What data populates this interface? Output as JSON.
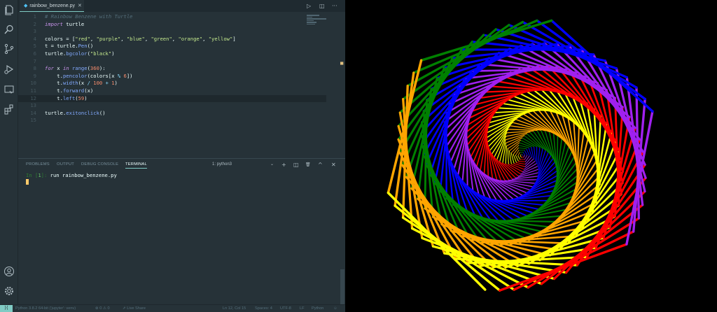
{
  "tab": {
    "filename": "rainbow_benzene.py",
    "close": "✕"
  },
  "editor_actions": {
    "run": "▷",
    "split": "◫",
    "more": "···"
  },
  "code_lines": [
    {
      "num": "1",
      "segments": [
        {
          "t": "# Rainbow Benzene with Turtle",
          "c": "cm"
        }
      ]
    },
    {
      "num": "2",
      "segments": [
        {
          "t": "import",
          "c": "kw"
        },
        {
          "t": " turtle",
          "c": ""
        }
      ]
    },
    {
      "num": "3",
      "segments": []
    },
    {
      "num": "4",
      "segments": [
        {
          "t": "colors = [",
          "c": ""
        },
        {
          "t": "\"red\"",
          "c": "st"
        },
        {
          "t": ", ",
          "c": ""
        },
        {
          "t": "\"purple\"",
          "c": "st"
        },
        {
          "t": ", ",
          "c": ""
        },
        {
          "t": "\"blue\"",
          "c": "st"
        },
        {
          "t": ", ",
          "c": ""
        },
        {
          "t": "\"green\"",
          "c": "st"
        },
        {
          "t": ", ",
          "c": ""
        },
        {
          "t": "\"orange\"",
          "c": "st"
        },
        {
          "t": ", ",
          "c": ""
        },
        {
          "t": "\"yellow\"",
          "c": "st"
        },
        {
          "t": "]",
          "c": ""
        }
      ]
    },
    {
      "num": "5",
      "segments": [
        {
          "t": "t = turtle.",
          "c": ""
        },
        {
          "t": "Pen",
          "c": "fn"
        },
        {
          "t": "()",
          "c": ""
        }
      ]
    },
    {
      "num": "6",
      "segments": [
        {
          "t": "turtle.",
          "c": ""
        },
        {
          "t": "bgcolor",
          "c": "fn"
        },
        {
          "t": "(",
          "c": ""
        },
        {
          "t": "\"black\"",
          "c": "st"
        },
        {
          "t": ")",
          "c": ""
        }
      ]
    },
    {
      "num": "7",
      "segments": []
    },
    {
      "num": "8",
      "segments": [
        {
          "t": "for",
          "c": "kw"
        },
        {
          "t": " x ",
          "c": ""
        },
        {
          "t": "in",
          "c": "kw"
        },
        {
          "t": " ",
          "c": ""
        },
        {
          "t": "range",
          "c": "fn"
        },
        {
          "t": "(",
          "c": ""
        },
        {
          "t": "360",
          "c": "nu"
        },
        {
          "t": "):",
          "c": ""
        }
      ]
    },
    {
      "num": "9",
      "segments": [
        {
          "t": "    t.",
          "c": ""
        },
        {
          "t": "pencolor",
          "c": "fn"
        },
        {
          "t": "(colors[x ",
          "c": ""
        },
        {
          "t": "%",
          "c": "op"
        },
        {
          "t": " ",
          "c": ""
        },
        {
          "t": "6",
          "c": "nu"
        },
        {
          "t": "])",
          "c": ""
        }
      ]
    },
    {
      "num": "10",
      "segments": [
        {
          "t": "    t.",
          "c": ""
        },
        {
          "t": "width",
          "c": "fn"
        },
        {
          "t": "(x ",
          "c": ""
        },
        {
          "t": "/",
          "c": "op"
        },
        {
          "t": " ",
          "c": ""
        },
        {
          "t": "100",
          "c": "nu"
        },
        {
          "t": " ",
          "c": ""
        },
        {
          "t": "+",
          "c": "op"
        },
        {
          "t": " ",
          "c": ""
        },
        {
          "t": "1",
          "c": "nu"
        },
        {
          "t": ")",
          "c": ""
        }
      ]
    },
    {
      "num": "11",
      "segments": [
        {
          "t": "    t.",
          "c": ""
        },
        {
          "t": "forward",
          "c": "fn"
        },
        {
          "t": "(x)",
          "c": ""
        }
      ]
    },
    {
      "num": "12",
      "segments": [
        {
          "t": "    t.",
          "c": ""
        },
        {
          "t": "left",
          "c": "fn"
        },
        {
          "t": "(",
          "c": ""
        },
        {
          "t": "59",
          "c": "nu"
        },
        {
          "t": ")",
          "c": ""
        }
      ],
      "active": true
    },
    {
      "num": "13",
      "segments": []
    },
    {
      "num": "14",
      "segments": [
        {
          "t": "turtle.",
          "c": ""
        },
        {
          "t": "exitonclick",
          "c": "fn"
        },
        {
          "t": "()",
          "c": ""
        }
      ]
    },
    {
      "num": "15",
      "segments": []
    }
  ],
  "panel": {
    "tabs": [
      "PROBLEMS",
      "OUTPUT",
      "DEBUG CONSOLE",
      "TERMINAL"
    ],
    "active_tab": "TERMINAL",
    "terminal_select": "1: python3",
    "actions": {
      "add": "+",
      "split": "◫",
      "trash": "🗑",
      "maximize": "^",
      "close": "✕"
    },
    "prompt_in": "In [",
    "prompt_num": "1",
    "prompt_close": "]: ",
    "command": "run rainbow_benzene.py"
  },
  "statusbar": {
    "remote": "⟩⟨",
    "interpreter": "Python 3.8.2 64-bit ('jupyter': venv)",
    "problems": "⊗ 0 ⚠ 0",
    "liveshare": "⇗ Live Share",
    "position": "Ln 12, Col 15",
    "spaces": "Spaces: 4",
    "encoding": "UTF-8",
    "eol": "LF",
    "language": "Python",
    "feedback": "☺"
  },
  "turtle": {
    "background": "#000000",
    "colors": [
      "red",
      "purple",
      "blue",
      "green",
      "orange",
      "yellow"
    ],
    "steps": 360,
    "turn_degrees": 59
  }
}
